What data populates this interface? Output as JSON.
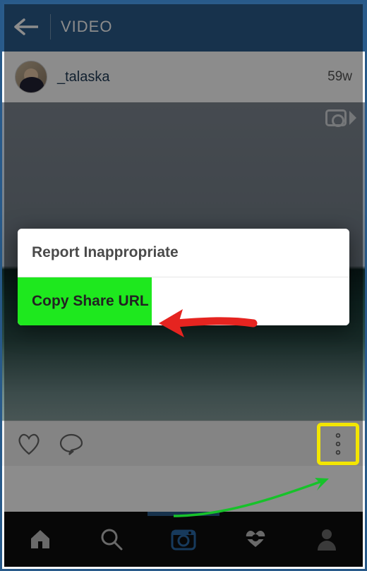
{
  "header": {
    "title": "VIDEO"
  },
  "post": {
    "username": "_talaska",
    "timestamp": "59w"
  },
  "modal": {
    "report_label": "Report Inappropriate",
    "copy_url_label": "Copy Share URL"
  },
  "nav": {
    "home": "home-icon",
    "search": "search-icon",
    "camera": "camera-icon",
    "activity": "activity-icon",
    "profile": "profile-icon"
  }
}
